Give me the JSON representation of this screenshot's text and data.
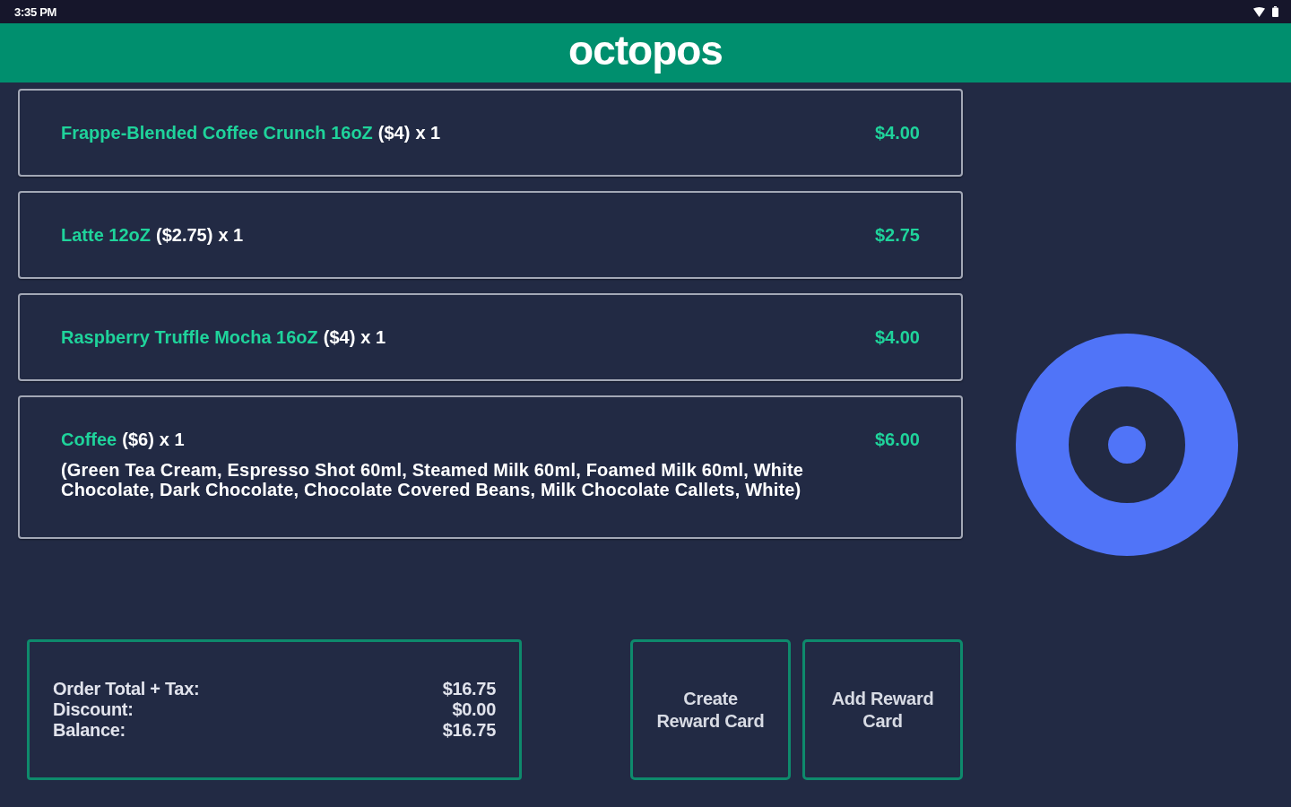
{
  "status_bar": {
    "time": "3:35 PM"
  },
  "header": {
    "logo": "octopos"
  },
  "order_items": [
    {
      "name": "Frappe-Blended Coffee Crunch 16oZ",
      "unit_price": "($4)",
      "quantity": "x 1",
      "price": "$4.00"
    },
    {
      "name": "Latte 12oZ",
      "unit_price": "($2.75)",
      "quantity": "x 1",
      "price": "$2.75"
    },
    {
      "name": "Raspberry Truffle Mocha 16oZ",
      "unit_price": "($4)",
      "quantity": "x 1",
      "price": "$4.00"
    },
    {
      "name": "Coffee",
      "unit_price": "($6)",
      "quantity": "x 1",
      "price": "$6.00",
      "modifiers": "(Green Tea Cream, Espresso Shot 60ml, Steamed Milk 60ml, Foamed Milk 60ml, White Chocolate, Dark Chocolate, Chocolate Covered Beans, Milk Chocolate Callets, White)"
    }
  ],
  "summary": {
    "rows": [
      {
        "label": "Order Total + Tax:",
        "value": "$16.75"
      },
      {
        "label": "Discount:",
        "value": "$0.00"
      },
      {
        "label": "Balance:",
        "value": "$16.75"
      }
    ]
  },
  "buttons": [
    {
      "label": "Create Reward Card"
    },
    {
      "label": "Add Reward Card"
    }
  ]
}
